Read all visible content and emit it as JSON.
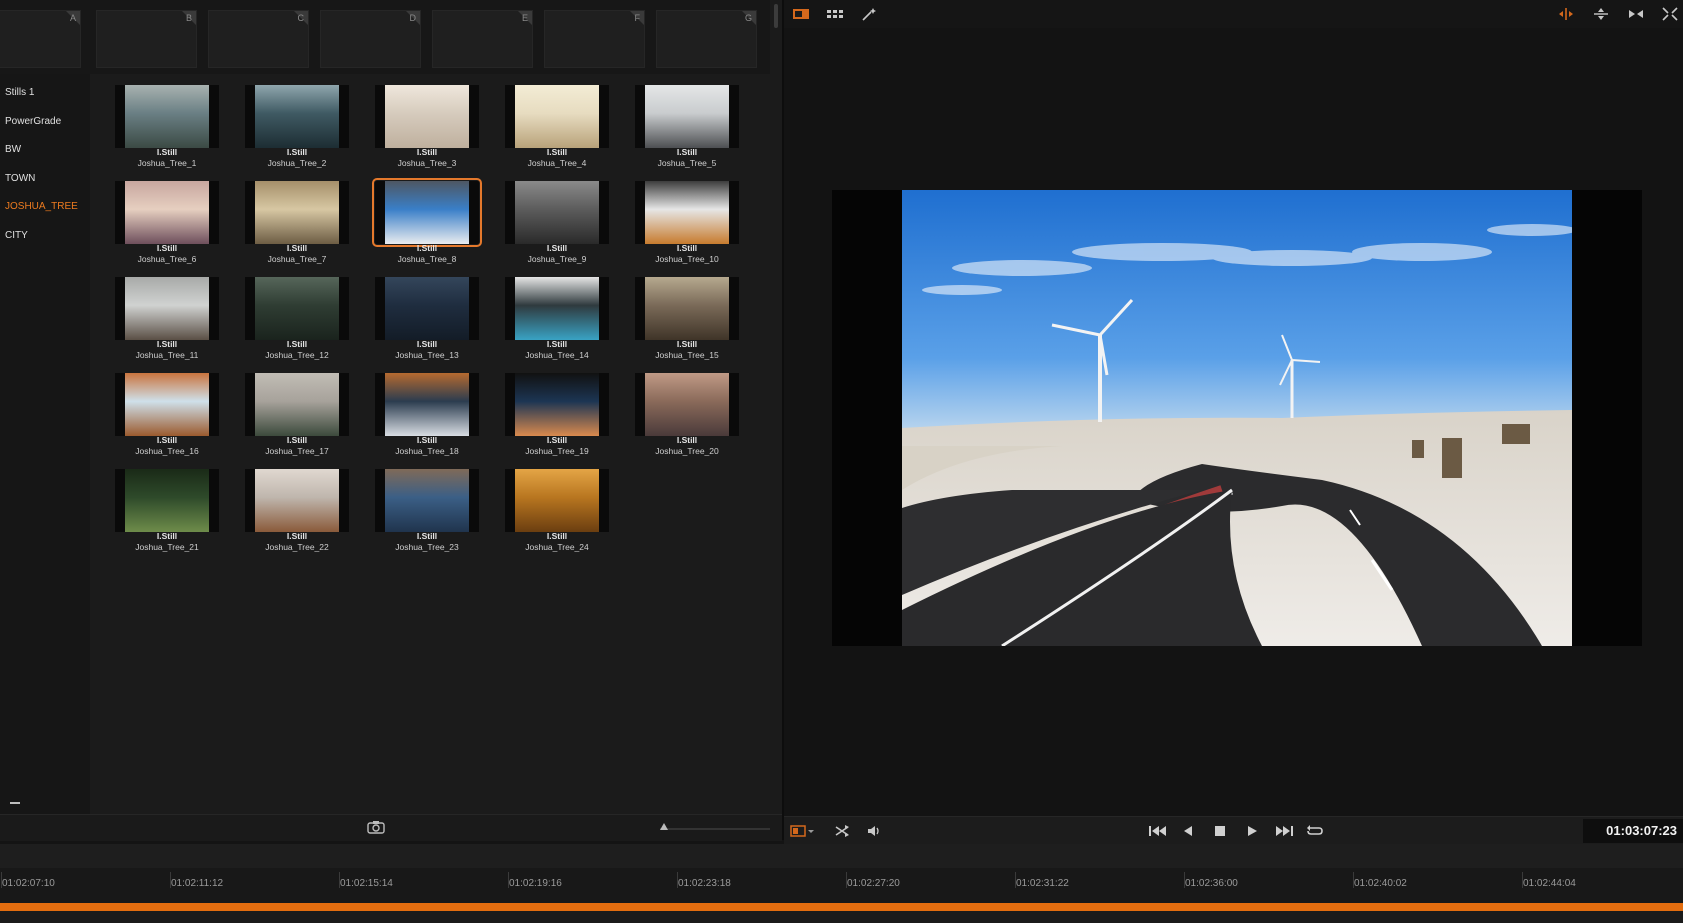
{
  "memories": [
    "A",
    "B",
    "C",
    "D",
    "E",
    "F",
    "G"
  ],
  "albums": [
    {
      "label": "Stills 1",
      "active": false
    },
    {
      "label": "PowerGrade",
      "active": false
    },
    {
      "label": "BW",
      "active": false
    },
    {
      "label": "TOWN",
      "active": false
    },
    {
      "label": "JOSHUA_TREE",
      "active": true
    },
    {
      "label": "CITY",
      "active": false
    }
  ],
  "stills": [
    {
      "type": "I.Still",
      "name": "Joshua_Tree_1",
      "colors": [
        "#6a7f84",
        "#3b4a44",
        "#a8b2b0"
      ]
    },
    {
      "type": "I.Still",
      "name": "Joshua_Tree_2",
      "colors": [
        "#3f5a63",
        "#1d2d33",
        "#8fa6ad"
      ]
    },
    {
      "type": "I.Still",
      "name": "Joshua_Tree_3",
      "colors": [
        "#d6cbbd",
        "#bfb09e",
        "#efe7dc"
      ]
    },
    {
      "type": "I.Still",
      "name": "Joshua_Tree_4",
      "colors": [
        "#e7dcc0",
        "#b8a27a",
        "#f3ecd5"
      ]
    },
    {
      "type": "I.Still",
      "name": "Joshua_Tree_5",
      "colors": [
        "#c9ccce",
        "#4d4f52",
        "#e4e6e7"
      ]
    },
    {
      "type": "I.Still",
      "name": "Joshua_Tree_6",
      "colors": [
        "#e6cfc0",
        "#6e4f5c",
        "#c7a69f"
      ]
    },
    {
      "type": "I.Still",
      "name": "Joshua_Tree_7",
      "colors": [
        "#d7c7a3",
        "#6d5d44",
        "#a58f6a"
      ]
    },
    {
      "type": "I.Still",
      "name": "Joshua_Tree_8",
      "colors": [
        "#3a7fc8",
        "#e9ecef",
        "#4e5763"
      ]
    },
    {
      "type": "I.Still",
      "name": "Joshua_Tree_9",
      "colors": [
        "#5c5c5c",
        "#2a2a2a",
        "#8a8a8a"
      ]
    },
    {
      "type": "I.Still",
      "name": "Joshua_Tree_10",
      "colors": [
        "#e6e6e6",
        "#c77b2e",
        "#3d3d3d"
      ]
    },
    {
      "type": "I.Still",
      "name": "Joshua_Tree_11",
      "colors": [
        "#d0d2d1",
        "#5a4f45",
        "#a8aaa8"
      ]
    },
    {
      "type": "I.Still",
      "name": "Joshua_Tree_12",
      "colors": [
        "#2f3d33",
        "#1a231d",
        "#56665a"
      ]
    },
    {
      "type": "I.Still",
      "name": "Joshua_Tree_13",
      "colors": [
        "#1f2d3f",
        "#131c27",
        "#34465b"
      ]
    },
    {
      "type": "I.Still",
      "name": "Joshua_Tree_14",
      "colors": [
        "#2f3a3e",
        "#39a3c4",
        "#e5e5e5"
      ]
    },
    {
      "type": "I.Still",
      "name": "Joshua_Tree_15",
      "colors": [
        "#7a6a58",
        "#3f3428",
        "#b6a98f"
      ]
    },
    {
      "type": "I.Still",
      "name": "Joshua_Tree_16",
      "colors": [
        "#cfe0ea",
        "#9b5a2e",
        "#c9743e"
      ]
    },
    {
      "type": "I.Still",
      "name": "Joshua_Tree_17",
      "colors": [
        "#a7a29b",
        "#3c4a3c",
        "#c1bdb5"
      ]
    },
    {
      "type": "I.Still",
      "name": "Joshua_Tree_18",
      "colors": [
        "#2b3c4f",
        "#d8dde3",
        "#b66a2f"
      ]
    },
    {
      "type": "I.Still",
      "name": "Joshua_Tree_19",
      "colors": [
        "#1c3553",
        "#d98a4e",
        "#111"
      ]
    },
    {
      "type": "I.Still",
      "name": "Joshua_Tree_20",
      "colors": [
        "#8a6a5a",
        "#4a3a3a",
        "#c09a86"
      ]
    },
    {
      "type": "I.Still",
      "name": "Joshua_Tree_21",
      "colors": [
        "#2e4a2a",
        "#6e8c4a",
        "#1a2a17"
      ]
    },
    {
      "type": "I.Still",
      "name": "Joshua_Tree_22",
      "colors": [
        "#bfb6ad",
        "#8a5a3a",
        "#e0d8d0"
      ]
    },
    {
      "type": "I.Still",
      "name": "Joshua_Tree_23",
      "colors": [
        "#3b5f86",
        "#20344d",
        "#7f6a58"
      ]
    },
    {
      "type": "I.Still",
      "name": "Joshua_Tree_24",
      "colors": [
        "#b87620",
        "#6b3e10",
        "#e4a546"
      ]
    }
  ],
  "selected_still": "Joshua_Tree_8",
  "viewer": {
    "timecode": "01:03:07:23"
  },
  "timeline": {
    "ruler": [
      "01:02:07:10",
      "01:02:11:12",
      "01:02:15:14",
      "01:02:19:16",
      "01:02:23:18",
      "01:02:27:20",
      "01:02:31:22",
      "01:02:36:00",
      "01:02:40:02",
      "01:02:44:04"
    ]
  },
  "colors": {
    "accent": "#e5792c",
    "playhead": "#e36d0f"
  },
  "icons": {
    "viewer_top_left": [
      "single-viewer-icon",
      "grid-view-icon",
      "magic-wand-icon"
    ],
    "viewer_top_right": [
      "split-wipe-icon",
      "move-icon",
      "compare-icon",
      "expand-icon"
    ],
    "transport": [
      "jump-start-icon",
      "step-back-icon",
      "stop-icon",
      "play-icon",
      "jump-end-icon",
      "loop-icon"
    ]
  }
}
